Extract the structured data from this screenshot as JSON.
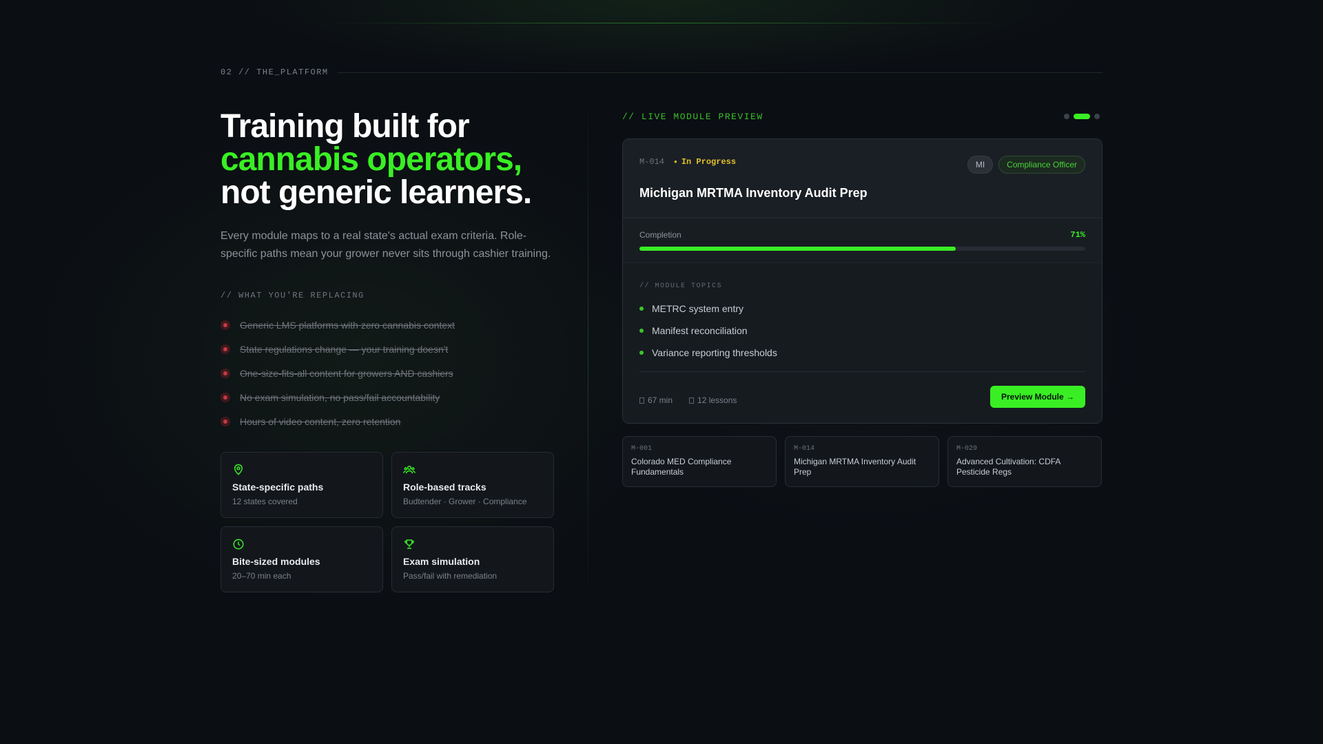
{
  "section": {
    "label": "02 // THE_PLATFORM"
  },
  "hero": {
    "line1": "Training built for",
    "line2": "cannabis operators,",
    "line3": "not generic learners.",
    "lede": "Every module maps to a real state's actual exam criteria. Role-specific paths mean your grower never sits through cashier training."
  },
  "replacing": {
    "label": "// WHAT YOU'RE REPLACING",
    "items": [
      "Generic LMS platforms with zero cannabis context",
      "State regulations change — your training doesn't",
      "One-size-fits-all content for growers AND cashiers",
      "No exam simulation, no pass/fail accountability",
      "Hours of video content, zero retention"
    ]
  },
  "features": [
    {
      "icon": "map-pin-icon",
      "title": "State-specific paths",
      "sub": "12 states covered"
    },
    {
      "icon": "users-icon",
      "title": "Role-based tracks",
      "sub": "Budtender · Grower · Compliance"
    },
    {
      "icon": "clock-icon",
      "title": "Bite-sized modules",
      "sub": "20–70 min each"
    },
    {
      "icon": "trophy-icon",
      "title": "Exam simulation",
      "sub": "Pass/fail with remediation"
    }
  ],
  "preview": {
    "label": "// LIVE MODULE PREVIEW",
    "pager": {
      "count": 3,
      "active": 1
    },
    "module": {
      "id": "M-014",
      "status": "In Progress",
      "state_tag": "MI",
      "role_tag": "Compliance Officer",
      "title": "Michigan MRTMA Inventory Audit Prep",
      "completion_label": "Completion",
      "completion_text": "71%",
      "completion_value": 0.71,
      "topics_label": "// MODULE TOPICS",
      "topics": [
        "METRC system entry",
        "Manifest reconciliation",
        "Variance reporting thresholds"
      ],
      "duration": "67 min",
      "lessons": "12 lessons",
      "cta": "Preview Module →"
    },
    "cards": [
      {
        "id": "M-001",
        "title": "Colorado MED Compliance Fundamentals"
      },
      {
        "id": "M-014",
        "title": "Michigan MRTMA Inventory Audit Prep"
      },
      {
        "id": "M-029",
        "title": "Advanced Cultivation: CDFA Pesticide Regs"
      }
    ]
  },
  "colors": {
    "accent": "#39ef24",
    "status": "#e2bf2c",
    "danger": "#c23a46",
    "background": "#0b0e13"
  }
}
